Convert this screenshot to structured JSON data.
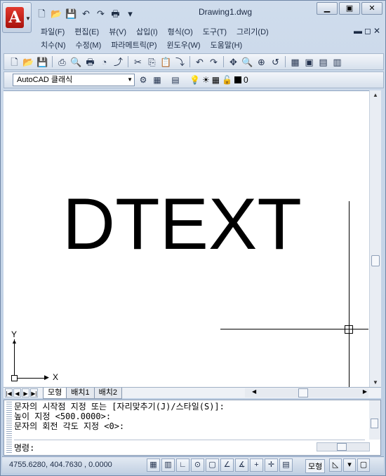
{
  "window": {
    "title": "Drawing1.dwg",
    "controls": [
      "▁",
      "▣",
      "✕"
    ]
  },
  "app_menu": {
    "logo": "A",
    "arrow": "▼"
  },
  "quick_access": [
    "🗋",
    "📂",
    "💾",
    "↶",
    "↷",
    "🖶",
    "▾"
  ],
  "menubar": {
    "row1": [
      "파일(F)",
      "편집(E)",
      "뷰(V)",
      "삽입(I)",
      "형식(O)",
      "도구(T)",
      "그리기(D)"
    ],
    "row2": [
      "치수(N)",
      "수정(M)",
      "파라메트릭(P)",
      "윈도우(W)",
      "도움말(H)"
    ],
    "mdi_controls": "▬◻✕"
  },
  "toolbar1": [
    "🗋",
    "📂",
    "💾",
    "⎙",
    "🔍",
    "🖶",
    "◔",
    "⤴",
    "✂",
    "⎘",
    "📋",
    "⤵",
    "↶",
    "↷",
    "✥",
    "🔍",
    "⊕",
    "↺",
    "▦",
    "▣",
    "▤",
    "▥"
  ],
  "workspace": {
    "value": "AutoCAD 클래식",
    "arrow": "▼",
    "icons": [
      "⚙",
      "▦"
    ]
  },
  "layer_controls": {
    "icons": [
      "▤",
      "💡",
      "☀",
      "▦",
      "🔓"
    ],
    "layer_name": "0"
  },
  "canvas": {
    "text": "DTEXT"
  },
  "ucs": {
    "x_label": "X",
    "y_label": "Y",
    "arrow_up": "▲",
    "arrow_right": "▶"
  },
  "layout_tabs": {
    "nav": [
      "|◀",
      "◀",
      "▶",
      "▶|"
    ],
    "tabs": [
      {
        "label": "모형",
        "active": true
      },
      {
        "label": "배치1",
        "active": false
      },
      {
        "label": "배치2",
        "active": false
      }
    ],
    "scroll_left": "◀",
    "scroll_right": "▶"
  },
  "command": {
    "history": [
      "문자의 시작점 지정 또는 [자리맞추기(J)/스타일(S)]:",
      "높이 지정 <500.0000>:",
      "문자의 회전 각도 지정 <0>:"
    ],
    "prompt": "명령:"
  },
  "statusbar": {
    "coordinates": "4755.6280, 404.7630 , 0.0000",
    "toggles": [
      "▦",
      "▥",
      "∟",
      "⊙",
      "▢",
      "∠",
      "∡",
      "+",
      "✛",
      "▤"
    ],
    "model_label": "모형",
    "right_icons": [
      "◺",
      "▾",
      "▢"
    ]
  }
}
